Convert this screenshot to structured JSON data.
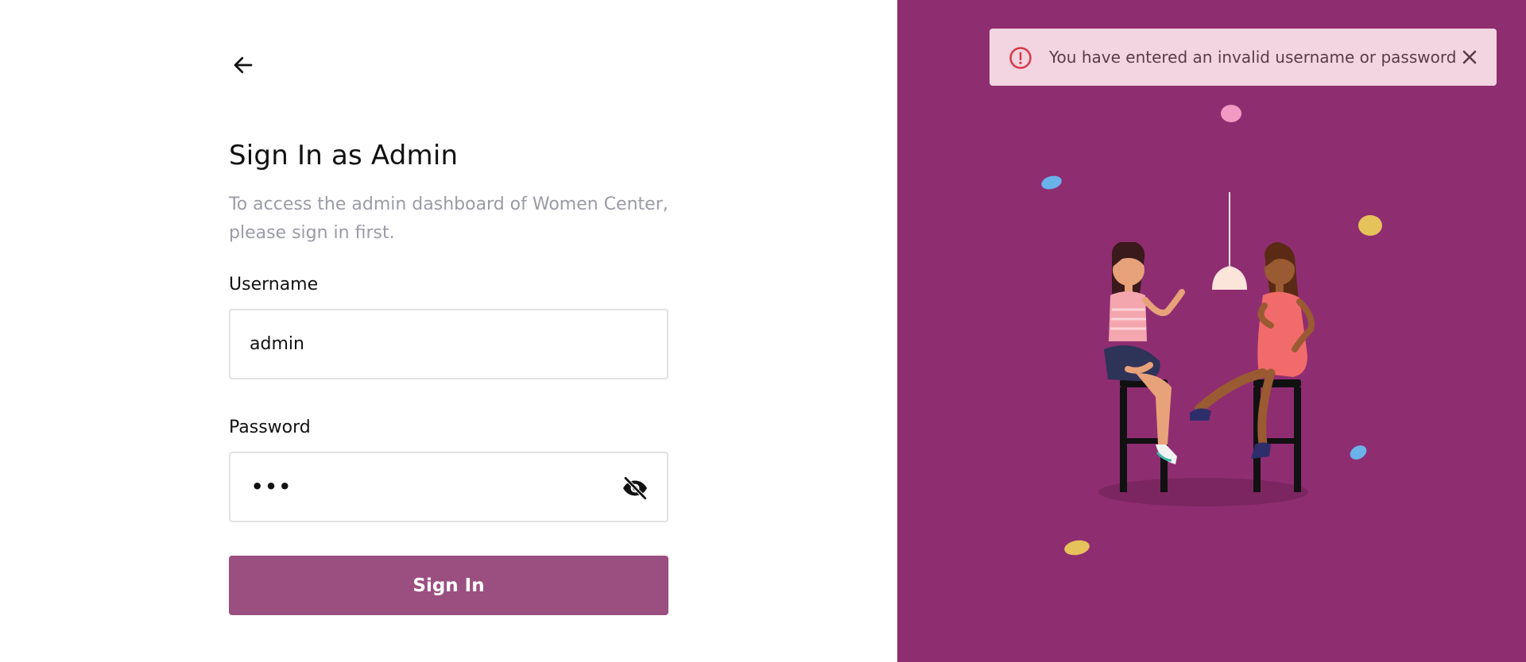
{
  "page": {
    "title": "Sign In as Admin",
    "subtitle": "To access the admin dashboard of Women Center, please sign in first."
  },
  "icons": {
    "back": "arrow-left-icon",
    "visibility": "eye-off-icon",
    "error": "exclamation-circle-icon",
    "close": "close-icon"
  },
  "form": {
    "username_label": "Username",
    "username_value": "admin",
    "password_label": "Password",
    "password_masked": "•••",
    "submit_label": "Sign In"
  },
  "toast": {
    "message": "You have entered an invalid username or password"
  },
  "colors": {
    "brand": "#8f2d71",
    "button": "#9b4f80",
    "toast_bg": "#f2d5e0",
    "error_red": "#d63a4a"
  }
}
